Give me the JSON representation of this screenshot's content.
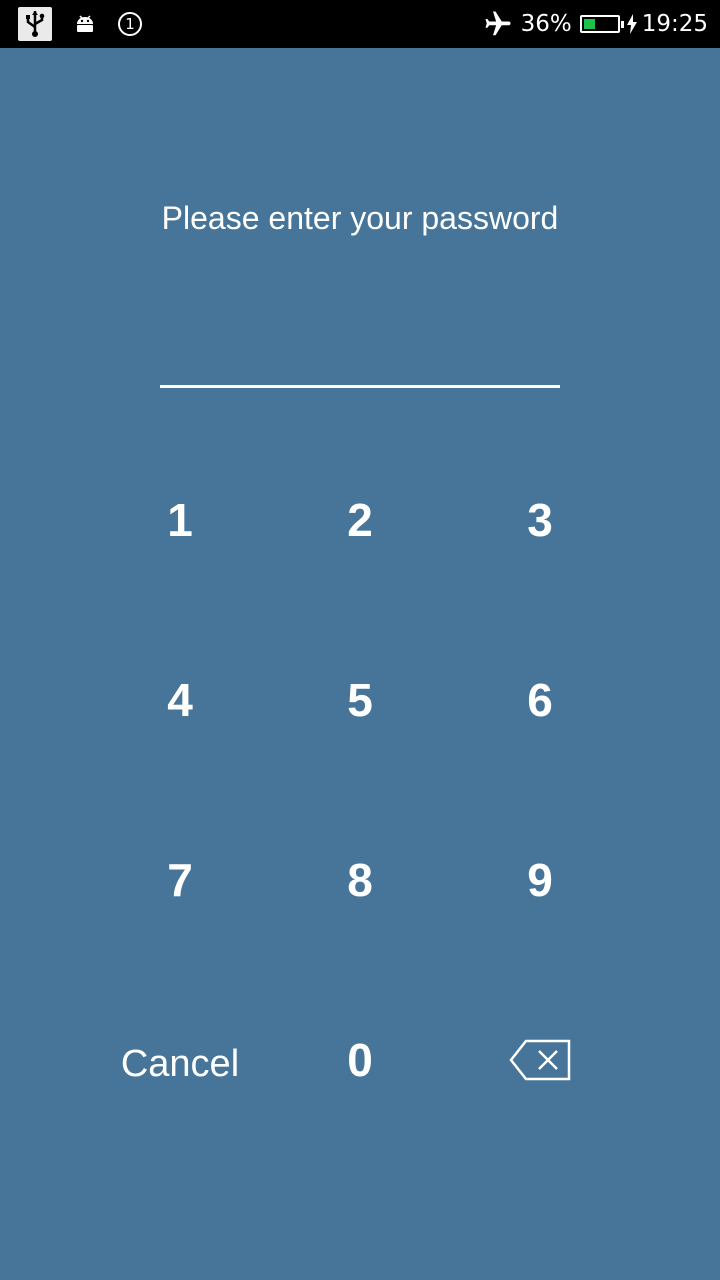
{
  "status_bar": {
    "battery_percent": "36%",
    "battery_level": 0.36,
    "time": "19:25",
    "notification_count": "1",
    "icons": [
      "usb-icon",
      "android-icon",
      "notification-count-icon",
      "airplane-mode-icon",
      "battery-icon",
      "charging-icon"
    ],
    "battery_color": "#1ec24a"
  },
  "screen": {
    "background_color": "#467599",
    "prompt": "Please enter your password",
    "password_value": ""
  },
  "keypad": {
    "keys": [
      "1",
      "2",
      "3",
      "4",
      "5",
      "6",
      "7",
      "8",
      "9"
    ],
    "zero": "0",
    "cancel_label": "Cancel",
    "backspace_icon": "backspace-icon"
  }
}
